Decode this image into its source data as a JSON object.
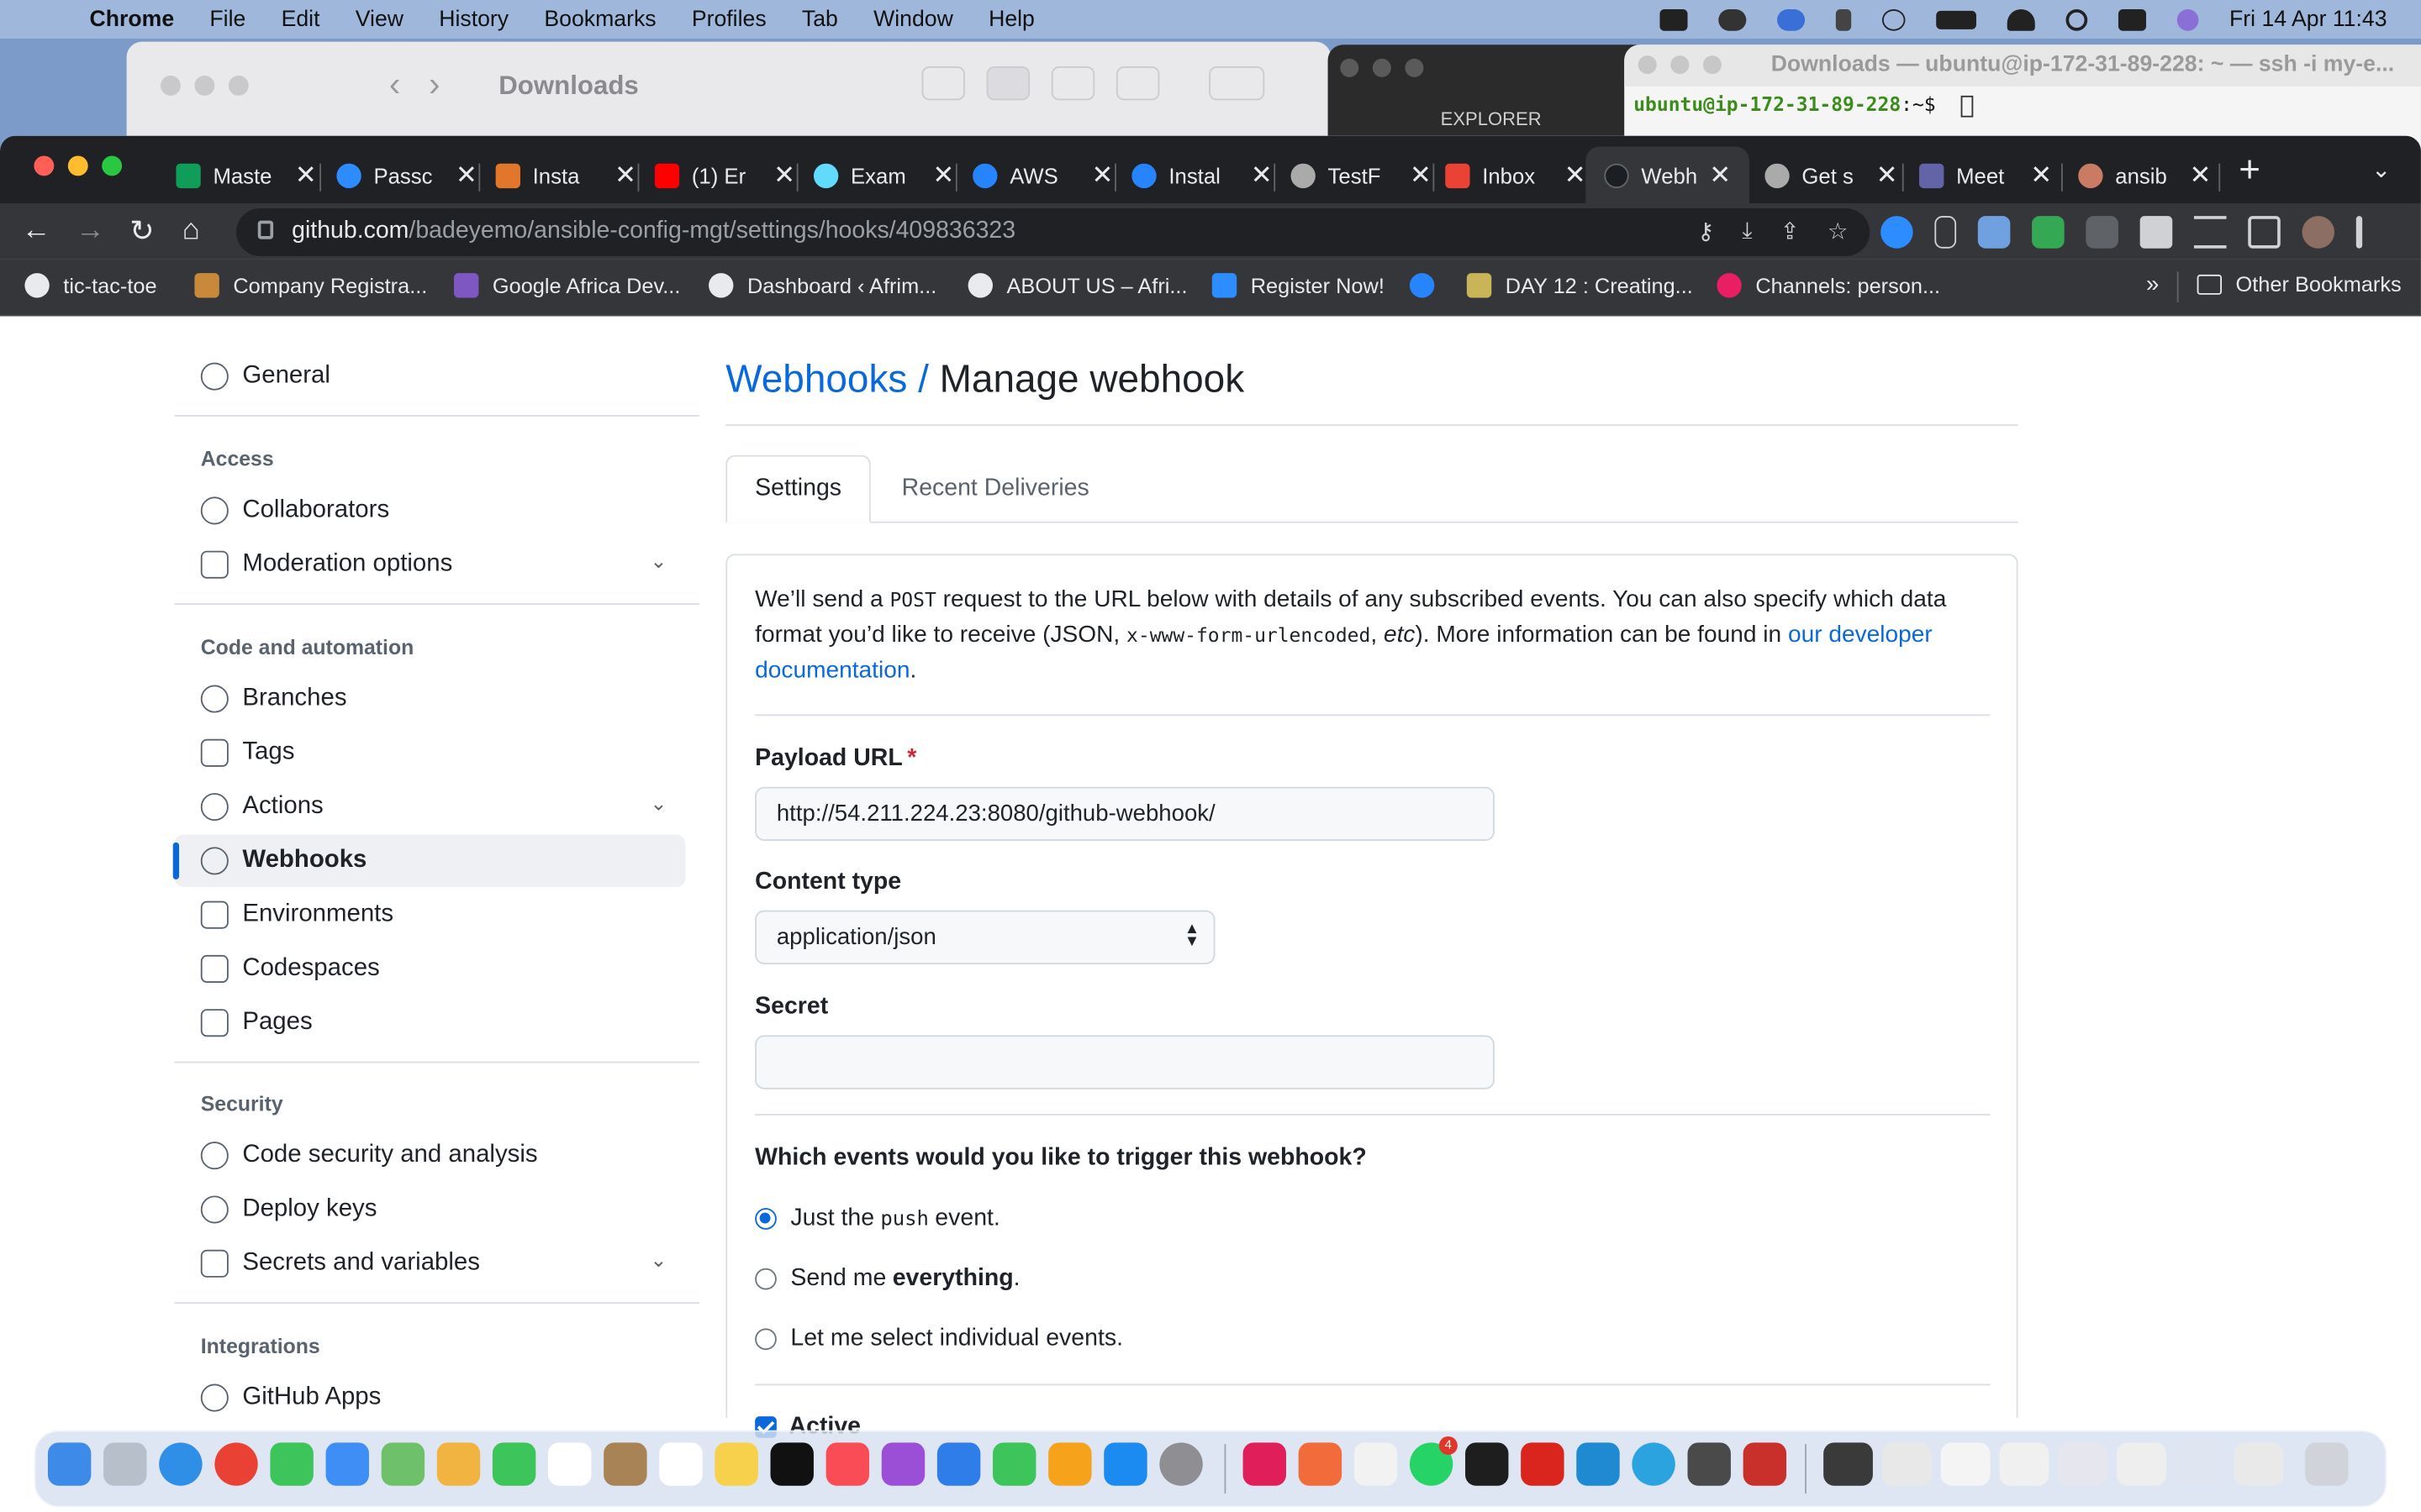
{
  "menubar": {
    "app": "Chrome",
    "items": [
      "File",
      "Edit",
      "View",
      "History",
      "Bookmarks",
      "Profiles",
      "Tab",
      "Window",
      "Help"
    ],
    "datetime": "Fri 14 Apr  11:43"
  },
  "finder": {
    "title": "Downloads"
  },
  "vscode": {
    "explorer": "EXPLORER"
  },
  "terminal": {
    "title": "Downloads — ubuntu@ip-172-31-89-228: ~ — ssh -i my-e...",
    "prompt_user": "ubuntu@ip-172-31-89-228",
    "prompt_path": ":~$"
  },
  "tabs": [
    {
      "label": "Maste",
      "color": "#0f9d58"
    },
    {
      "label": "Passc",
      "color": "#2d8cff"
    },
    {
      "label": "Insta",
      "color": "#e2762b"
    },
    {
      "label": "(1) Er",
      "color": "#ff0000"
    },
    {
      "label": "Exam",
      "color": "#61dafb"
    },
    {
      "label": "AWS",
      "color": "#2684ff"
    },
    {
      "label": "Instal",
      "color": "#2684ff"
    },
    {
      "label": "TestF",
      "color": "#aaaaaa"
    },
    {
      "label": "Inbox",
      "color": "#ea4335"
    },
    {
      "label": "Webh",
      "color": "#1b1f23"
    },
    {
      "label": "Get s",
      "color": "#aaaaaa"
    },
    {
      "label": "Meet",
      "color": "#6264a7"
    },
    {
      "label": "ansib",
      "color": "#c97b63"
    }
  ],
  "omnibox": {
    "host": "github.com",
    "path": "/badeyemo/ansible-config-mgt/settings/hooks/409836323"
  },
  "bookmarks": [
    {
      "label": "tic-tac-toe",
      "color": "#e8eaed"
    },
    {
      "label": "Company Registra...",
      "color": "#c88a3a"
    },
    {
      "label": "Google Africa Dev...",
      "color": "#7e57c2"
    },
    {
      "label": "Dashboard ‹ Afrim...",
      "color": "#e8eaed"
    },
    {
      "label": "ABOUT US – Afri...",
      "color": "#e8eaed"
    },
    {
      "label": "Register Now!",
      "color": "#2d8cff"
    },
    {
      "label": "DAY 12 : Creating...",
      "color": "#c9b458"
    },
    {
      "label": "Channels: person...",
      "color": "#e91e63"
    }
  ],
  "bookmarks_more": "»",
  "other_bookmarks": "Other Bookmarks",
  "sidebar": {
    "general": "General",
    "access_heading": "Access",
    "collaborators": "Collaborators",
    "moderation": "Moderation options",
    "code_heading": "Code and automation",
    "branches": "Branches",
    "tags": "Tags",
    "actions": "Actions",
    "webhooks": "Webhooks",
    "environments": "Environments",
    "codespaces": "Codespaces",
    "pages": "Pages",
    "security_heading": "Security",
    "code_security": "Code security and analysis",
    "deploy_keys": "Deploy keys",
    "secrets": "Secrets and variables",
    "integrations_heading": "Integrations",
    "github_apps": "GitHub Apps"
  },
  "main": {
    "crumb_link": "Webhooks /",
    "crumb_current": "Manage webhook",
    "tab_settings": "Settings",
    "tab_deliveries": "Recent Deliveries",
    "intro_1": "We’ll send a ",
    "intro_post": "POST",
    "intro_2": " request to the URL below with details of any subscribed events. You can also specify which data format you’d like to receive (JSON, ",
    "intro_form": "x-www-form-urlencoded",
    "intro_3": ", ",
    "intro_etc": "etc",
    "intro_4": "). More information can be found in ",
    "intro_link": "our developer documentation",
    "intro_5": ".",
    "payload_label": "Payload URL",
    "payload_required": "*",
    "payload_value": "http://54.211.224.23:8080/github-webhook/",
    "content_type_label": "Content type",
    "content_type_value": "application/json",
    "secret_label": "Secret",
    "secret_value": "",
    "events_question": "Which events would you like to trigger this webhook?",
    "event_push_1": "Just the",
    "event_push_code": "push",
    "event_push_2": "event.",
    "event_all_1": "Send me",
    "event_all_bold": "everything",
    "event_all_2": ".",
    "event_select": "Let me select individual events.",
    "active_label": "Active"
  }
}
